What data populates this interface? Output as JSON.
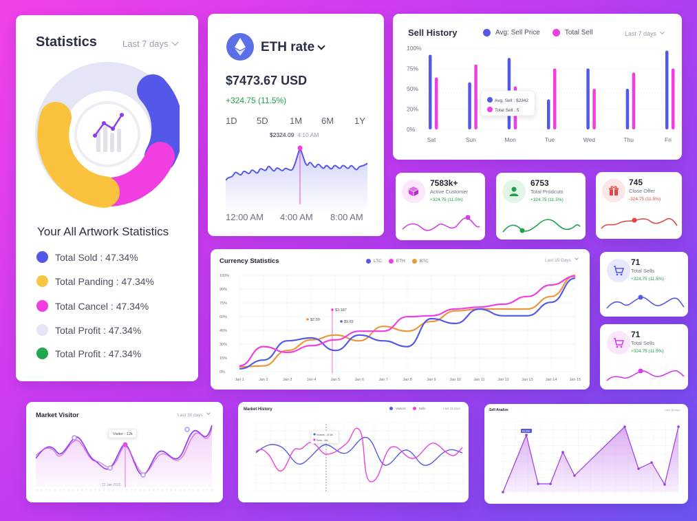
{
  "statistics": {
    "title": "Statistics",
    "period": "Last 7 days",
    "subtitle": "Your All Artwork Statistics",
    "legend": [
      {
        "label": "Total Sold",
        "value": "47.34%",
        "color": "#5458e8"
      },
      {
        "label": "Total Panding",
        "value": "47.34%",
        "color": "#f7c744"
      },
      {
        "label": "Total Cancel",
        "value": "47.34%",
        "color": "#f13ee0"
      },
      {
        "label": "Total Profit",
        "value": "47.34%",
        "color": "#e4e5f7"
      },
      {
        "label": "Total Profit",
        "value": "47.34%",
        "color": "#20a84f"
      }
    ],
    "colors": {
      "sold": "#5458e8",
      "panding": "#f7c744",
      "cancel": "#f13ee0",
      "profit": "#e4e5f7"
    }
  },
  "eth": {
    "title": "ETH rate",
    "price": "$7473.67 USD",
    "change": "+324.75 (11.5%)",
    "ranges": [
      "1D",
      "5D",
      "1M",
      "6M",
      "1Y"
    ],
    "tooltip_value": "$2324.09",
    "tooltip_time": "4:10 AM",
    "x_labels": [
      "12:00 AM",
      "4:00 AM",
      "8:00 AM"
    ],
    "icon": "ethereum-icon"
  },
  "sell_history": {
    "title": "Sell History",
    "legend": [
      {
        "label": "Avg: Sell Price",
        "color": "#5458e8"
      },
      {
        "label": "Total Sell",
        "color": "#f13ee0"
      }
    ],
    "period": "Last 7 days",
    "y_labels": [
      "100%",
      "75%",
      "50%",
      "20%",
      "0%"
    ],
    "tooltip": {
      "avg": "Avg. Sell : $2342",
      "total": "Total Sell : 5"
    }
  },
  "kpis": [
    {
      "value": "7583k+",
      "label": "Active Customer",
      "change": "+324.75 (11.5%)",
      "icon": "box-icon",
      "color": "#d63de8",
      "tint": "#fbe6fb",
      "change_color": "green"
    },
    {
      "value": "6753",
      "label": "Total Prodcuts",
      "change": "+324.75 (11.5%)",
      "icon": "user-icon",
      "color": "#1ea14c",
      "tint": "#e2f6e8",
      "change_color": "green"
    },
    {
      "value": "745",
      "label": "Close Offer",
      "change": "-324.75 (11.5%)",
      "icon": "gift-icon",
      "color": "#e04545",
      "tint": "#fde6e6",
      "change_color": "red"
    }
  ],
  "sells": [
    {
      "value": "71",
      "label": "Total Sells",
      "change": "+324.75 (11.5%)",
      "icon": "cart-icon",
      "color": "#5458e8",
      "tint": "#e7e8fc"
    },
    {
      "value": "71",
      "label": "Total Sells",
      "change": "+324.75 (11.5%)",
      "icon": "cart-icon",
      "color": "#d63de8",
      "tint": "#fbe6fb"
    }
  ],
  "currency": {
    "title": "Currency Statistics",
    "legend": [
      {
        "label": "LTC",
        "color": "#5458e8"
      },
      {
        "label": "ETH",
        "color": "#f13ee0"
      },
      {
        "label": "BTC",
        "color": "#f0963a"
      }
    ],
    "period": "Last 15 Days",
    "y_labels": [
      "100%",
      "90%",
      "75%",
      "60%",
      "45%",
      "30%",
      "15%",
      "0%"
    ],
    "annotations": [
      "$2.99",
      "$3.187",
      "$9.65"
    ]
  },
  "market_visitor": {
    "title": "Market Visitor",
    "period": "Last 30 days",
    "tooltip": "Visitor : 12k",
    "date": "12 Jan 2022"
  },
  "market_history": {
    "title": "Market History",
    "legend": [
      {
        "label": "Visitors",
        "color": "#5458e8"
      },
      {
        "label": "Sells",
        "color": "#f13ee0"
      }
    ],
    "period": "Last 15 days",
    "tooltip": {
      "visitors": "Visitors : 20.6k",
      "sells": "Sells : 45k"
    }
  },
  "sell_analize": {
    "title": "Sell Analize",
    "period": "Last 15 days",
    "tooltip": "$3,848"
  },
  "chart_data": [
    {
      "type": "bar",
      "title": "Sell History",
      "categories": [
        "Sat",
        "Sun",
        "Mon",
        "Tue",
        "Wed",
        "Thu",
        "Fri"
      ],
      "series": [
        {
          "name": "Avg: Sell Price",
          "values": [
            92,
            58,
            88,
            37,
            75,
            50,
            97
          ]
        },
        {
          "name": "Total Sell",
          "values": [
            64,
            80,
            53,
            75,
            50,
            70,
            75
          ]
        }
      ],
      "ylim": [
        0,
        100
      ]
    },
    {
      "type": "line",
      "title": "Currency Statistics",
      "categories": [
        "Jan 1",
        "Jan 2",
        "Jan 3",
        "Jan 4",
        "Jan 5",
        "Jan 6",
        "Jan 7",
        "Jan 8",
        "Jan 9",
        "Jan 10",
        "Jan 11",
        "Jan 12",
        "Jan 13",
        "Jan 14",
        "Jan 15"
      ],
      "series": [
        {
          "name": "LTC",
          "values": [
            3,
            12,
            32,
            35,
            22,
            38,
            32,
            26,
            55,
            50,
            65,
            58,
            58,
            72,
            97
          ]
        },
        {
          "name": "ETH",
          "values": [
            6,
            26,
            20,
            27,
            33,
            42,
            42,
            57,
            58,
            65,
            67,
            70,
            78,
            90,
            99
          ]
        },
        {
          "name": "BTC",
          "values": [
            5,
            6,
            22,
            33,
            38,
            32,
            47,
            42,
            52,
            63,
            65,
            65,
            65,
            78,
            102
          ]
        }
      ],
      "ylim": [
        0,
        100
      ]
    },
    {
      "type": "bar",
      "title": "Statistics",
      "categories": [
        "Total Sold",
        "Total Panding",
        "Total Cancel",
        "Total Profit",
        "Total Profit"
      ],
      "values": [
        47.34,
        47.34,
        47.34,
        47.34,
        47.34
      ]
    }
  ]
}
